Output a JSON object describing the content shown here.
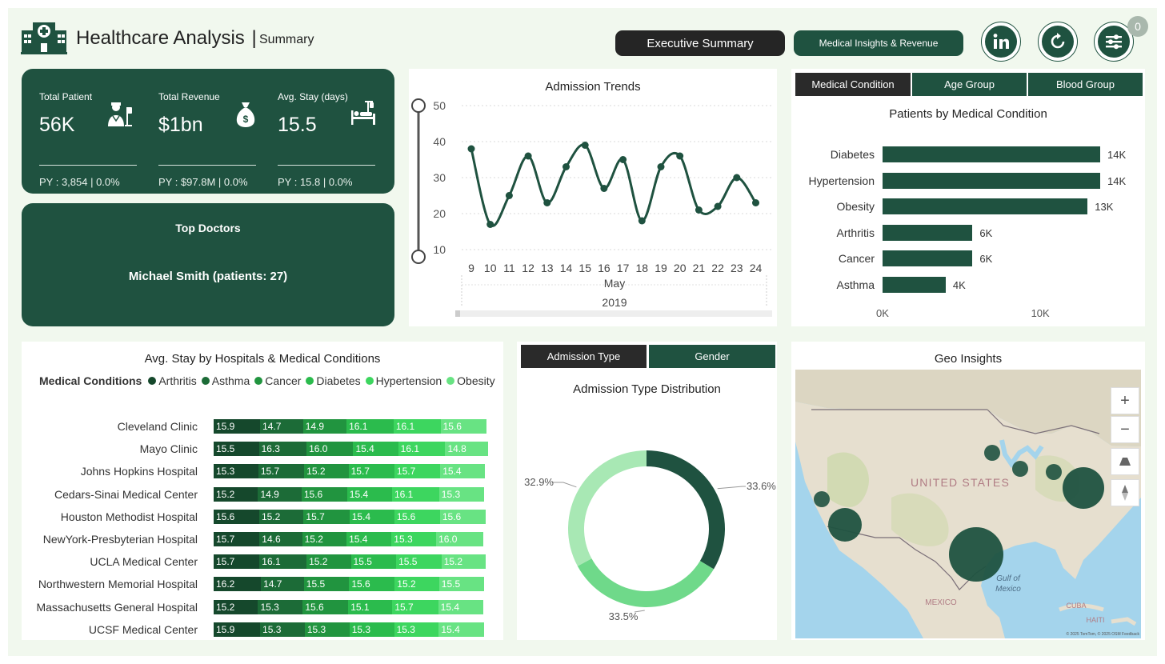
{
  "header": {
    "title": "Healthcare Analysis",
    "separator": "|",
    "subtitle": "Summary",
    "nav": [
      {
        "label": "Executive Summary"
      },
      {
        "label": "Medical Insights & Revenue"
      }
    ],
    "filter_badge": "0"
  },
  "kpis": [
    {
      "label": "Total Patient",
      "value": "56K",
      "py": "PY : 3,854 | 0.0%",
      "icon": "doctor-icon"
    },
    {
      "label": "Total Revenue",
      "value": "$1bn",
      "py": "PY : $97.8M | 0.0%",
      "icon": "money-bag-icon"
    },
    {
      "label": "Avg. Stay (days)",
      "value": "15.5",
      "py": "PY : 15.8 | 0.0%",
      "icon": "hospital-bed-icon"
    }
  ],
  "top_doctors": {
    "title": "Top Doctors",
    "value": "Michael Smith (patients: 27)"
  },
  "admission_trends": {
    "title": "Admission Trends",
    "x_month": "May",
    "x_year": "2019"
  },
  "condition_tabs": [
    {
      "label": "Medical Condition",
      "active": true
    },
    {
      "label": "Age Group",
      "active": false
    },
    {
      "label": "Blood Group",
      "active": false
    }
  ],
  "condition_chart": {
    "title": "Patients by Medical Condition"
  },
  "avg_stay": {
    "title": "Avg. Stay by Hospitals & Medical Conditions",
    "legend_title": "Medical Conditions",
    "conditions": [
      "Arthritis",
      "Asthma",
      "Cancer",
      "Diabetes",
      "Hypertension",
      "Obesity"
    ],
    "colors": [
      "#15482c",
      "#1c6b37",
      "#21943f",
      "#2bbb4d",
      "#3dd65f",
      "#68e383"
    ]
  },
  "admission_tabs": [
    {
      "label": "Admission Type",
      "active": true
    },
    {
      "label": "Gender",
      "active": false
    }
  ],
  "admission_dist": {
    "title": "Admission Type Distribution"
  },
  "geo": {
    "title": "Geo Insights",
    "country_label": "UNITED STATES",
    "labels": [
      "MEXICO",
      "Gulf of",
      "Mexico",
      "CUBA",
      "HAITI"
    ],
    "credit": "© 2025 TomTom, © 2025 OSM  Feedback",
    "controls": [
      "zoom-in",
      "zoom-out",
      "tilt",
      "compass"
    ]
  },
  "chart_data": [
    {
      "type": "line",
      "title": "Admission Trends",
      "x": [
        9,
        10,
        11,
        12,
        13,
        14,
        15,
        16,
        17,
        18,
        19,
        20,
        21,
        22,
        23,
        24
      ],
      "y": [
        38,
        17,
        25,
        36,
        23,
        33,
        39,
        27,
        35,
        18,
        33,
        36,
        21,
        22,
        30,
        23
      ],
      "xlabel": "May 2019",
      "ylim": [
        10,
        50
      ],
      "yticks": [
        10,
        20,
        30,
        40,
        50
      ],
      "grid": true
    },
    {
      "type": "bar",
      "orientation": "horizontal",
      "title": "Patients by Medical Condition",
      "categories": [
        "Diabetes",
        "Hypertension",
        "Obesity",
        "Arthritis",
        "Cancer",
        "Asthma"
      ],
      "values": [
        13800,
        13800,
        13000,
        5700,
        5700,
        4000
      ],
      "data_labels": [
        "14K",
        "14K",
        "13K",
        "6K",
        "6K",
        "4K"
      ],
      "xticks": [
        "0K",
        "10K"
      ],
      "xlim": [
        0,
        14000
      ]
    },
    {
      "type": "bar",
      "orientation": "horizontal",
      "stacked": true,
      "title": "Avg. Stay by Hospitals & Medical Conditions",
      "categories": [
        "Cleveland Clinic",
        "Mayo Clinic",
        "Johns Hopkins Hospital",
        "Cedars-Sinai Medical Center",
        "Houston Methodist Hospital",
        "NewYork-Presbyterian Hospital",
        "UCLA Medical Center",
        "Northwestern Memorial Hospital",
        "Massachusetts General Hospital",
        "UCSF Medical Center"
      ],
      "series": [
        {
          "name": "Arthritis",
          "values": [
            15.9,
            15.5,
            15.3,
            15.2,
            15.6,
            15.7,
            15.7,
            16.2,
            15.2,
            15.9
          ]
        },
        {
          "name": "Asthma",
          "values": [
            14.7,
            16.3,
            15.7,
            14.9,
            15.2,
            14.6,
            16.1,
            14.7,
            15.3,
            15.3
          ]
        },
        {
          "name": "Cancer",
          "values": [
            14.9,
            16.0,
            15.2,
            15.6,
            15.7,
            15.2,
            15.2,
            15.5,
            15.6,
            15.3
          ]
        },
        {
          "name": "Diabetes",
          "values": [
            16.1,
            15.4,
            15.7,
            15.4,
            15.4,
            15.4,
            15.5,
            15.6,
            15.1,
            15.3
          ]
        },
        {
          "name": "Hypertension",
          "values": [
            16.1,
            16.1,
            15.7,
            16.1,
            15.6,
            15.3,
            15.5,
            15.2,
            15.7,
            15.3
          ]
        },
        {
          "name": "Obesity",
          "values": [
            15.6,
            14.8,
            15.4,
            15.3,
            15.6,
            16.0,
            15.2,
            15.5,
            15.4,
            15.4
          ]
        }
      ]
    },
    {
      "type": "pie",
      "donut": true,
      "title": "Admission Type Distribution",
      "values": [
        33.6,
        33.5,
        32.9
      ],
      "labels": [
        "33.6%",
        "33.5%",
        "32.9%"
      ],
      "colors": [
        "#1f5240",
        "#6fd98a",
        "#a8e8b4"
      ]
    }
  ]
}
